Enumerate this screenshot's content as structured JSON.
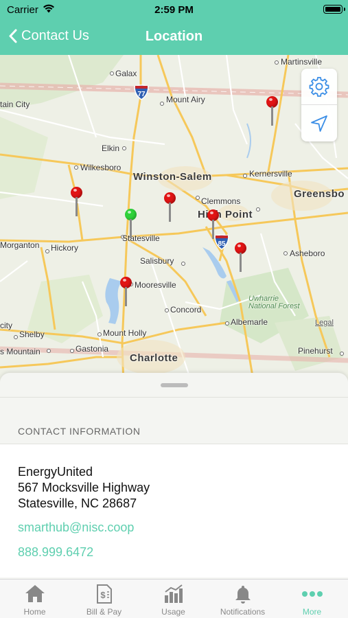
{
  "status_bar": {
    "carrier": "Carrier",
    "time": "2:59 PM"
  },
  "nav": {
    "back_label": "Contact Us",
    "title": "Location"
  },
  "map": {
    "labels": {
      "galax": "Galax",
      "martinsville": "Martinsville",
      "mount_airy": "Mount Airy",
      "tain_city": "tain City",
      "elkin": "Elkin",
      "wilkesboro": "Wilkesboro",
      "winston_salem": "Winston-Salem",
      "kernersville": "Kernersville",
      "greensboro": "Greensbo",
      "clemmons": "Clemmons",
      "high_point": "High Point",
      "morganton": "Morganton",
      "hickory": "Hickory",
      "statesville": "Statesville",
      "salisbury": "Salisbury",
      "asheboro": "Asheboro",
      "mooresville": "Mooresville",
      "concord": "Concord",
      "uwharrie": "Uwharrie\nNational Forest",
      "city": "city",
      "albemarle": "Albemarle",
      "legal": "Legal",
      "shelby": "Shelby",
      "mount_holly": "Mount Holly",
      "s_mountain": "s Mountain",
      "gastonia": "Gastonia",
      "charlotte": "Charlotte",
      "pinehurst": "Pinehurst"
    },
    "shields": {
      "i77": "77",
      "i85": "85"
    },
    "pins": [
      {
        "name": "pin-1",
        "color": "red"
      },
      {
        "name": "pin-2",
        "color": "red"
      },
      {
        "name": "pin-3",
        "color": "red"
      },
      {
        "name": "pin-4",
        "color": "green"
      },
      {
        "name": "pin-5",
        "color": "red"
      },
      {
        "name": "pin-6",
        "color": "red"
      },
      {
        "name": "pin-7",
        "color": "red"
      }
    ],
    "controls": [
      "gear-icon",
      "location-arrow-icon"
    ]
  },
  "contact": {
    "section_header": "CONTACT INFORMATION",
    "name": "EnergyUnited",
    "street": "567 Mocksville Highway",
    "city_state_zip": "Statesville, NC 28687",
    "email": "smarthub@nisc.coop",
    "phone": "888.999.6472"
  },
  "tabbar": {
    "items": [
      {
        "label": "Home",
        "icon": "home-icon"
      },
      {
        "label": "Bill & Pay",
        "icon": "bill-icon"
      },
      {
        "label": "Usage",
        "icon": "usage-chart-icon"
      },
      {
        "label": "Notifications",
        "icon": "bell-icon"
      },
      {
        "label": "More",
        "icon": "more-dots-icon"
      }
    ],
    "active": "More"
  },
  "colors": {
    "accent": "#5ecfaf",
    "pin_red": "#e11414",
    "pin_green": "#2fd23a"
  }
}
